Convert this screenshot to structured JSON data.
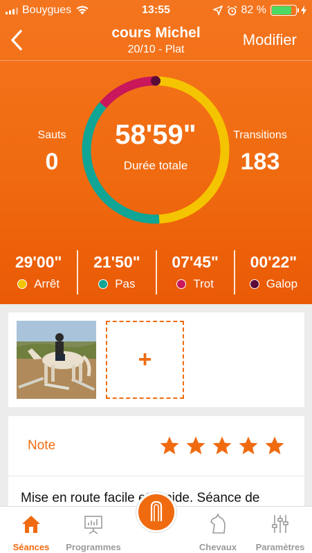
{
  "status_bar": {
    "carrier": "Bouygues",
    "time": "13:55",
    "battery_percent": "82 %",
    "battery_level": 0.82
  },
  "nav": {
    "title": "cours Michel",
    "subtitle": "20/10 - Plat",
    "edit_label": "Modifier",
    "back_icon": "chevron-left-icon"
  },
  "summary": {
    "total_duration": "58'59\"",
    "total_label": "Durée totale",
    "jumps_label": "Sauts",
    "jumps_value": "0",
    "transitions_label": "Transitions",
    "transitions_value": "183"
  },
  "gaits": [
    {
      "time": "29'00\"",
      "name": "Arrêt",
      "color": "#f5c400",
      "minutes": 29.0
    },
    {
      "time": "21'50\"",
      "name": "Pas",
      "color": "#10a594",
      "minutes": 21.833
    },
    {
      "time": "07'45\"",
      "name": "Trot",
      "color": "#c8175a",
      "minutes": 7.75
    },
    {
      "time": "00'22\"",
      "name": "Galop",
      "color": "#5a0b3a",
      "minutes": 0.367
    }
  ],
  "photos": {
    "add_label": "+",
    "photo_subject": "rider on horse over poles"
  },
  "note": {
    "label": "Note",
    "rating": 5,
    "max_rating": 5,
    "text": "Mise en route facile et rapide. Séance de"
  },
  "tabs": [
    {
      "label": "Séances",
      "icon": "home-icon",
      "active": true
    },
    {
      "label": "Programmes",
      "icon": "presentation-icon",
      "active": false
    },
    {
      "label": "Chevaux",
      "icon": "horse-head-icon",
      "active": false
    },
    {
      "label": "Paramètres",
      "icon": "sliders-icon",
      "active": false
    }
  ],
  "colors": {
    "accent": "#f06b10",
    "header_top": "#f4751f",
    "header_bottom": "#ea5a06"
  }
}
